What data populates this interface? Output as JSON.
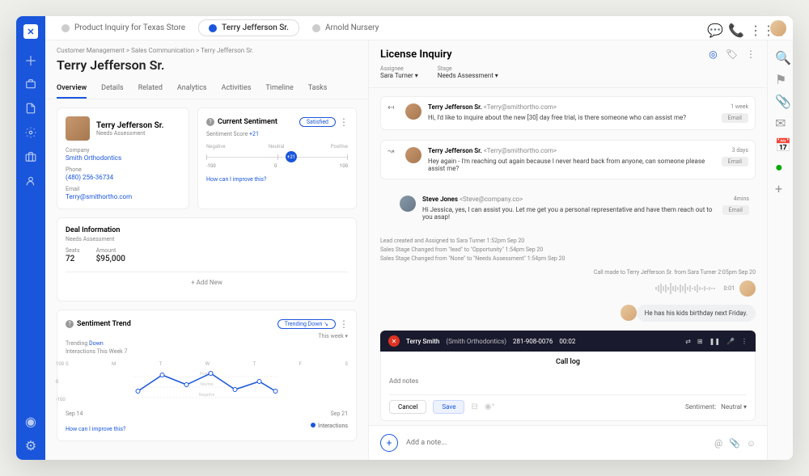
{
  "tabs": [
    {
      "label": "Product Inquiry for Texas Store",
      "active": false,
      "iconColor": "#ccc"
    },
    {
      "label": "Terry Jefferson Sr.",
      "active": true,
      "iconColor": "#1a56db"
    },
    {
      "label": "Arnold Nursery",
      "active": false,
      "iconColor": "#ccc"
    }
  ],
  "breadcrumb": "Customer Management  >  Sales Communication > Terry Jefferson Sr.",
  "pageTitle": "Terry Jefferson Sr.",
  "subTabs": [
    "Overview",
    "Details",
    "Related",
    "Analytics",
    "Activities",
    "Timeline",
    "Tasks"
  ],
  "activeSubTab": "Overview",
  "profile": {
    "name": "Terry Jefferson Sr.",
    "subtitle": "Needs Assessment",
    "companyLabel": "Company",
    "company": "Smith Orthodontics",
    "phoneLabel": "Phone",
    "phone": "(480) 256-36734",
    "emailLabel": "Email",
    "email": "Terry@smithortho.com"
  },
  "sentiment": {
    "title": "Current Sentiment",
    "badge": "Satisfied",
    "scoreLabel": "Sentiment Score ",
    "score": "+21",
    "labels": {
      "neg": "Negative",
      "neu": "Neutral",
      "pos": "Positive"
    },
    "nums": {
      "min": "-100",
      "mid": "0",
      "max": "100"
    },
    "dot": "+21",
    "improve": "How can I improve this?"
  },
  "deal": {
    "title": "Deal Information",
    "subtitle": "Needs Assessment",
    "seatsLabel": "Seats",
    "seats": "72",
    "amountLabel": "Amount",
    "amount": "$95,000",
    "addNew": "+ Add New"
  },
  "trend": {
    "title": "Sentiment Trend",
    "badge": "Trending Down",
    "sub1": "Trending ",
    "sub1b": "Down",
    "sub2": "Interactions This Week ",
    "sub2b": "7",
    "thisWeek": "This week  ▾",
    "days": [
      "S",
      "M",
      "T",
      "W",
      "T",
      "F",
      "S"
    ],
    "bands": {
      "pos": "Positive",
      "neu": "Neutral",
      "neg": "Negative"
    },
    "y": {
      "top": "100",
      "mid": "0",
      "bot": "-100"
    },
    "dates": {
      "start": "Sep 14",
      "end": "Sep 21"
    },
    "improve": "How can I improve this?",
    "legend": "Interactions"
  },
  "conv": {
    "title": "License Inquiry",
    "assigneeLabel": "Assignee",
    "assignee": "Sara Turner  ▾",
    "stageLabel": "Stage",
    "stage": "Needs Assessment  ▾"
  },
  "messages": [
    {
      "from": "Terry Jefferson Sr.",
      "email": "<Terry@smithortho.com>",
      "time": "1 week",
      "btn": "Email",
      "text": "Hi, I'd like to inquire about the new [30] day free trial, is there someone who can assist me?"
    },
    {
      "from": "Terry Jefferson Sr.",
      "email": "<Terry@smithortho.com>",
      "time": "3 days",
      "btn": "Email",
      "text": "Hey again - I'm reaching out again because I never heard back from anyone, can someone please assist me?"
    },
    {
      "from": "Steve Jones",
      "email": "<Steve@company.co>",
      "time": "4mins",
      "btn": "Email",
      "text": "Hi Jessica, yes, I can assist you.  Let me get you a personal representative and have them reach out to you asap!"
    }
  ],
  "activity": [
    "Lead created and Assigned to Sara Turner 1:52pm Sep 20",
    "Sales Stage Changed from \"lead\" to \"Opportunity\" 1:54pm Sep 20",
    "Sales Stage Changed from \"None\" to \"Needs Assessment\" 1:54pm Sep 20"
  ],
  "callMade": "Call made to Terry Jefferson Sr. from Sara Turner 2:05pm Sep 20",
  "waveTime": "0:01",
  "noteBubble": "He has his kids birthday next Friday.",
  "callBar": {
    "name": "Terry Smith",
    "co": "(Smith Orthodontics)",
    "phone": "281-908-0076",
    "time": "00:02"
  },
  "callLog": {
    "title": "Call log",
    "placeholder": "Add notes",
    "cancel": "Cancel",
    "save": "Save",
    "sentimentLabel": "Sentiment:",
    "sentimentValue": "Neutral  ▾"
  },
  "addNote": {
    "placeholder": "Add a note..."
  }
}
